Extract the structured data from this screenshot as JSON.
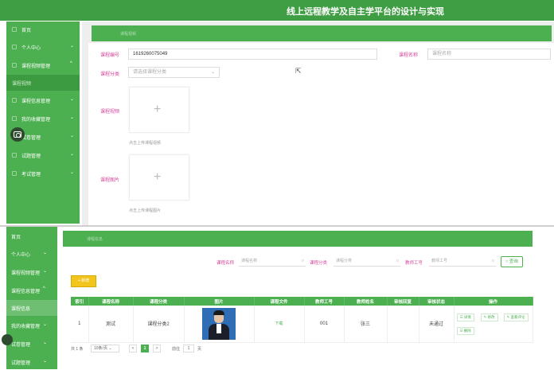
{
  "app_title": "线上远程教学及自主学平台的设计与实现",
  "top_sidebar": {
    "items": [
      {
        "label": "首页",
        "chevron": ""
      },
      {
        "label": "个人中心",
        "chevron": "⌄"
      },
      {
        "label": "课程视频管理",
        "chevron": "^"
      },
      {
        "label": "课程视频",
        "chevron": ""
      },
      {
        "label": "课程信息管理",
        "chevron": "⌄"
      },
      {
        "label": "我的收藏管理",
        "chevron": "⌄"
      },
      {
        "label": "试卷管理",
        "chevron": "⌄"
      },
      {
        "label": "试题管理",
        "chevron": "⌄"
      },
      {
        "label": "考试管理",
        "chevron": "⌄"
      }
    ]
  },
  "top_breadcrumb": "课程视频",
  "form": {
    "course_no_label": "课程编号",
    "course_no_value": "1619260075049",
    "course_name_label": "课程名称",
    "course_name_placeholder": "课程名称",
    "category_label": "课程分类",
    "category_placeholder": "请选择课程分类",
    "video_label": "课程视频",
    "video_hint": "点击上传课程视频",
    "image_label": "课程图片",
    "image_hint": "点击上传课程图片",
    "plus_symbol": "+"
  },
  "bottom_sidebar": {
    "items": [
      {
        "label": "首页",
        "chevron": ""
      },
      {
        "label": "个人中心",
        "chevron": "⌄"
      },
      {
        "label": "课程视频管理",
        "chevron": "⌄"
      },
      {
        "label": "课程信息管理",
        "chevron": "^"
      },
      {
        "label": "课程信息",
        "chevron": ""
      },
      {
        "label": "我的收藏管理",
        "chevron": "⌄"
      },
      {
        "label": "试卷管理",
        "chevron": "⌄"
      },
      {
        "label": "试题管理",
        "chevron": "⌄"
      }
    ]
  },
  "bottom_breadcrumb": "课程信息",
  "search": {
    "name_label": "课程名称",
    "name_placeholder": "课程名称",
    "category_label": "课程分类",
    "category_placeholder": "课程分类",
    "teacher_label": "教师工号",
    "teacher_placeholder": "教师工号",
    "query_button": "○ 查询",
    "search_icon": "○"
  },
  "add_button": "+ 新增",
  "table": {
    "headers": [
      "索引",
      "课程名称",
      "课程分类",
      "图片",
      "课程文件",
      "教师工号",
      "教师姓名",
      "审核回复",
      "审核状态",
      "操作"
    ],
    "rows": [
      {
        "index": "1",
        "name": "测试",
        "category": "课程分类2",
        "file": "下载",
        "teacher_no": "001",
        "teacher_name": "张三",
        "review_reply": "",
        "review_status": "未通过"
      }
    ],
    "actions": {
      "detail": "☰ 详情",
      "edit": "✎ 修改",
      "comments": "✎ 查看评论",
      "delete": "☰ 删除"
    }
  },
  "pagination": {
    "total": "共 1 条",
    "page_size": "10条/页",
    "prev": "<",
    "current": "1",
    "next": ">",
    "goto_label": "前往",
    "goto_value": "1",
    "page_suffix": "页"
  },
  "icons": {
    "camera": "camera-icon",
    "pointer": "cursor-arrow"
  },
  "colors": {
    "primary": "#4caf50",
    "label_pink": "#d6459b",
    "add_yellow": "#f2c51c",
    "photo_blue": "#2f6db5"
  }
}
